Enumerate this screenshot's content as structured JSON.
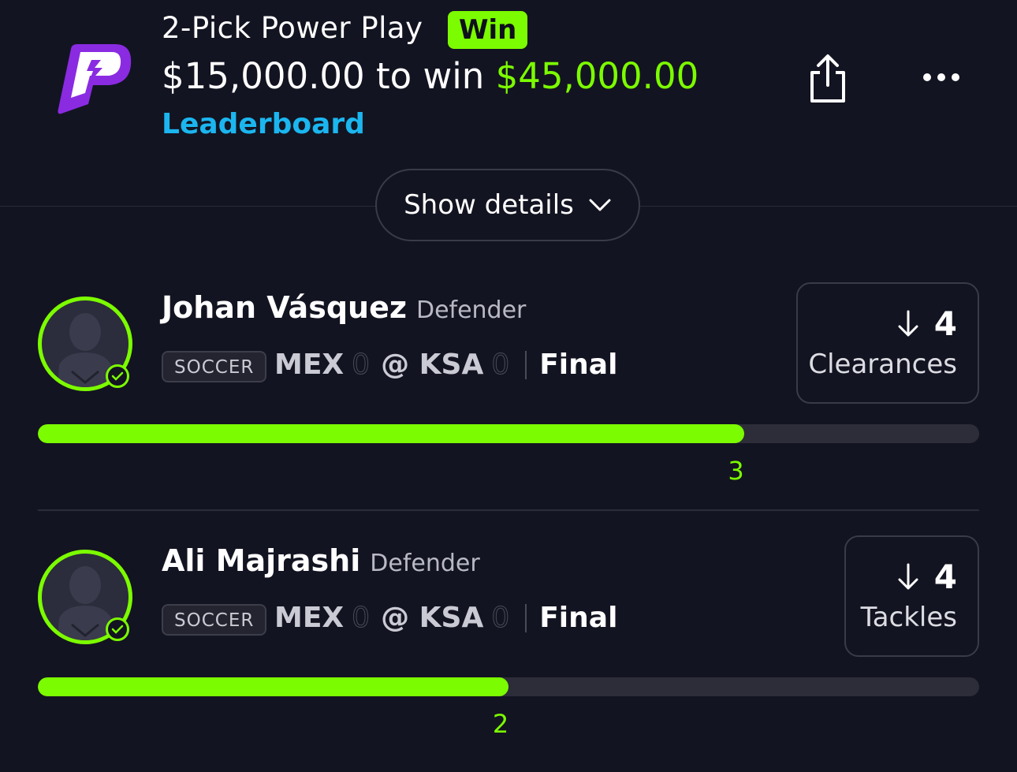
{
  "header": {
    "title": "2-Pick Power Play",
    "result_badge": "Win",
    "stake": "$15,000.00",
    "to_win_text": "to win",
    "payout": "$45,000.00",
    "leaderboard_label": "Leaderboard",
    "show_details_label": "Show details"
  },
  "colors": {
    "accent_green": "#7cfc00",
    "link_blue": "#1bb6f0",
    "brand_purple": "#8a2be2",
    "background": "#131421"
  },
  "picks": [
    {
      "player": "Johan Vásquez",
      "position": "Defender",
      "sport": "SOCCER",
      "away_team": "MEX",
      "away_score": "0",
      "at": "@",
      "home_team": "KSA",
      "home_score": "0",
      "status": "Final",
      "direction_icon": "arrow-down-icon",
      "line": "4",
      "stat": "Clearances",
      "actual": "3",
      "progress_fraction": 0.75
    },
    {
      "player": "Ali Majrashi",
      "position": "Defender",
      "sport": "SOCCER",
      "away_team": "MEX",
      "away_score": "0",
      "at": "@",
      "home_team": "KSA",
      "home_score": "0",
      "status": "Final",
      "direction_icon": "arrow-down-icon",
      "line": "4",
      "stat": "Tackles",
      "actual": "2",
      "progress_fraction": 0.5
    }
  ]
}
